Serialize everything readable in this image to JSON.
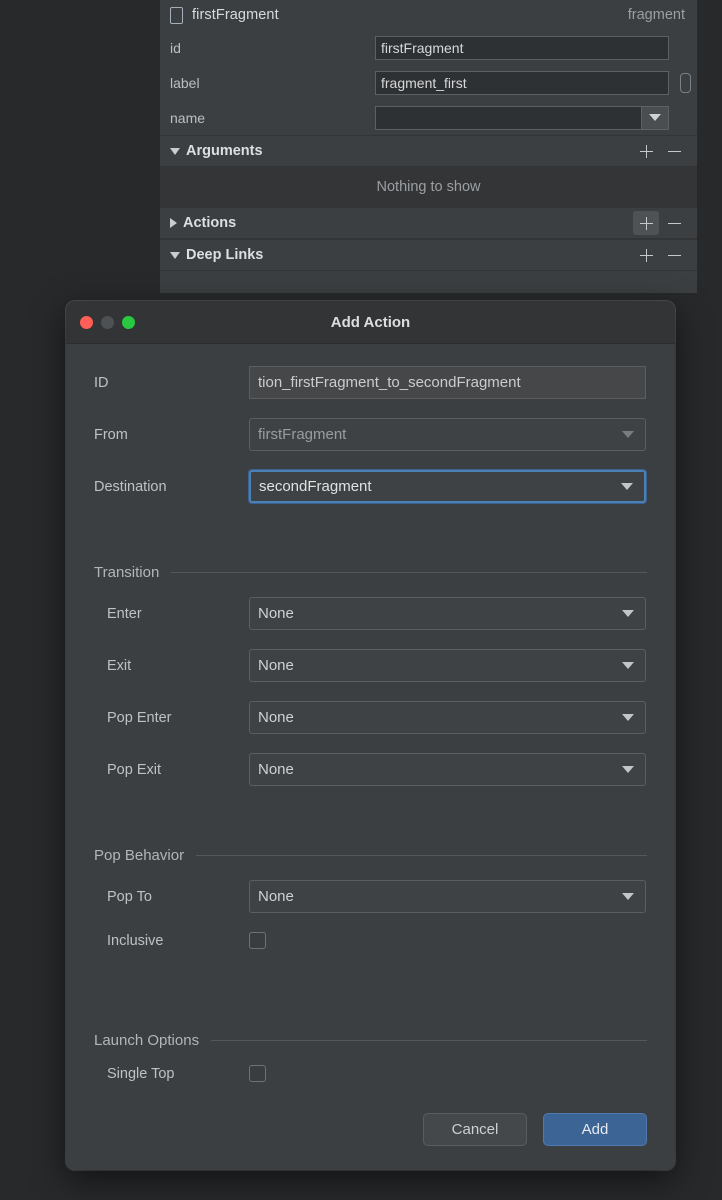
{
  "attributes_panel": {
    "icon": "fragment-phone-icon",
    "title": "firstFragment",
    "type": "fragment",
    "fields": [
      {
        "label": "id",
        "value": "firstFragment",
        "kind": "text",
        "has_resource_picker": false
      },
      {
        "label": "label",
        "value": "fragment_first",
        "kind": "text",
        "has_resource_picker": true
      },
      {
        "label": "name",
        "value": "",
        "kind": "combo",
        "has_resource_picker": false
      }
    ],
    "sections": [
      {
        "title": "Arguments",
        "expanded": true,
        "add_label": "+",
        "remove_label": "−",
        "empty_text": "Nothing to show",
        "add_hover": false
      },
      {
        "title": "Actions",
        "expanded": false,
        "add_label": "+",
        "remove_label": "−",
        "empty_text": "",
        "add_hover": true
      },
      {
        "title": "Deep Links",
        "expanded": true,
        "add_label": "+",
        "remove_label": "−",
        "empty_text": "",
        "add_hover": false
      }
    ]
  },
  "dialog": {
    "title": "Add Action",
    "window_buttons": {
      "close": "close-button",
      "minimize": "minimize-button",
      "zoom": "zoom-button"
    },
    "fields": {
      "id": {
        "label": "ID",
        "value": "tion_firstFragment_to_secondFragment",
        "placeholder": ""
      },
      "from": {
        "label": "From",
        "value": "firstFragment",
        "state": "disabled"
      },
      "destination": {
        "label": "Destination",
        "value": "secondFragment",
        "state": "focused"
      }
    },
    "transition": {
      "group_label": "Transition",
      "rows": [
        {
          "label": "Enter",
          "value": "None"
        },
        {
          "label": "Exit",
          "value": "None"
        },
        {
          "label": "Pop Enter",
          "value": "None"
        },
        {
          "label": "Pop Exit",
          "value": "None"
        }
      ]
    },
    "pop_behavior": {
      "group_label": "Pop Behavior",
      "pop_to": {
        "label": "Pop To",
        "value": "None"
      },
      "inclusive": {
        "label": "Inclusive",
        "checked": false
      }
    },
    "launch_options": {
      "group_label": "Launch Options",
      "single_top": {
        "label": "Single Top",
        "checked": false
      }
    },
    "buttons": {
      "cancel": "Cancel",
      "add": "Add"
    }
  },
  "colors": {
    "panel_bg": "#3c3f41",
    "dialog_bg": "#3c3f41",
    "titlebar_bg": "#323436",
    "desktop_bg": "#27292b",
    "accent_focus": "#4b7fb5",
    "accent_primary_button": "#3c6596",
    "light_red": "#ff5f57",
    "light_gray": "#4e5154",
    "light_green": "#28c840"
  }
}
